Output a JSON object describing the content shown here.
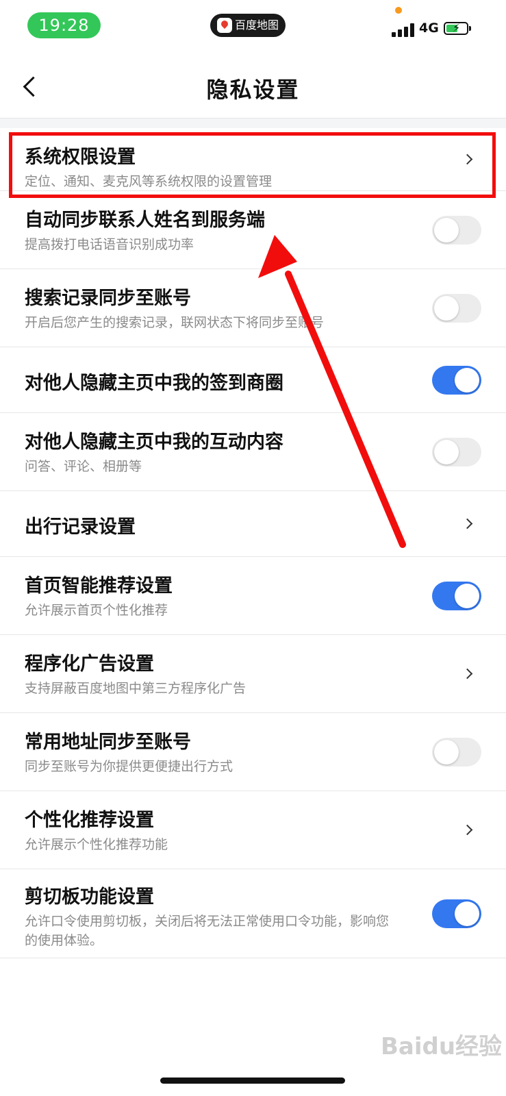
{
  "status": {
    "time": "19:28",
    "app_name": "百度地图",
    "network": "4G",
    "battery_level": 0.6
  },
  "nav": {
    "title": "隐私设置"
  },
  "colors": {
    "toggle_on": "#3478f0",
    "highlight": "#f20d0d",
    "time_pill": "#33c759"
  },
  "items": [
    {
      "title": "系统权限设置",
      "subtitle": "定位、通知、麦克风等系统权限的设置管理",
      "control": "chevron"
    },
    {
      "title": "自动同步联系人姓名到服务端",
      "subtitle": "提高拨打电话语音识别成功率",
      "control": "toggle",
      "on": false
    },
    {
      "title": "搜索记录同步至账号",
      "subtitle": "开启后您产生的搜索记录，联网状态下将同步至账号",
      "control": "toggle",
      "on": false
    },
    {
      "title": "对他人隐藏主页中我的签到商圈",
      "subtitle": "",
      "control": "toggle",
      "on": true
    },
    {
      "title": "对他人隐藏主页中我的互动内容",
      "subtitle": "问答、评论、相册等",
      "control": "toggle",
      "on": false
    },
    {
      "title": "出行记录设置",
      "subtitle": "",
      "control": "chevron"
    },
    {
      "title": "首页智能推荐设置",
      "subtitle": "允许展示首页个性化推荐",
      "control": "toggle",
      "on": true
    },
    {
      "title": "程序化广告设置",
      "subtitle": "支持屏蔽百度地图中第三方程序化广告",
      "control": "chevron"
    },
    {
      "title": "常用地址同步至账号",
      "subtitle": "同步至账号为你提供更便捷出行方式",
      "control": "toggle",
      "on": false
    },
    {
      "title": "个性化推荐设置",
      "subtitle": "允许展示个性化推荐功能",
      "control": "chevron"
    },
    {
      "title": "剪切板功能设置",
      "subtitle": "允许口令使用剪切板，关闭后将无法正常使用口令功能，影响您的使用体验。",
      "control": "toggle",
      "on": true
    }
  ],
  "watermark": "Baidu经验"
}
